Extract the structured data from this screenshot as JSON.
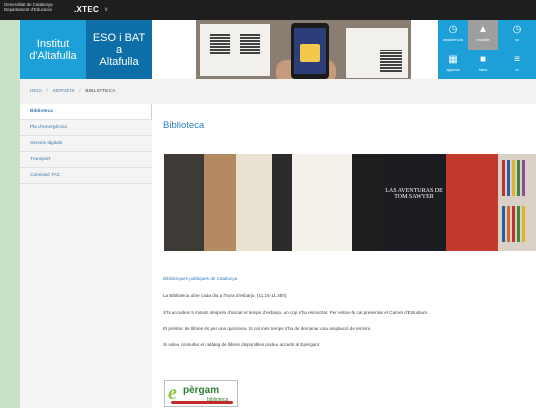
{
  "topbar": {
    "gencat_line1": "Generalitat de Catalunya",
    "gencat_line2": "Departament d'Educació",
    "xtec_label": ".XTEC",
    "xtec_chevron": "∨"
  },
  "banner": {
    "institut_label": "Institut\nd'Altafulla",
    "eso_label": "ESO i BAT a\nAltafulla",
    "tiles": [
      {
        "label": "assistència",
        "icon": "clock-icon",
        "color": "#1d9fd8"
      },
      {
        "label": "moodle",
        "icon": "graduation-cap-icon",
        "color": "#9e9e9e"
      },
      {
        "label": "co",
        "icon": "clock-icon",
        "color": "#1d9fd8"
      },
      {
        "label": "agenda",
        "icon": "calendar-icon",
        "color": "#1d9fd8"
      },
      {
        "label": "fotos",
        "icon": "camera-icon",
        "color": "#1d9fd8"
      },
      {
        "label": "m",
        "icon": "menu-icon",
        "color": "#1d9fd8"
      }
    ]
  },
  "breadcrumb": {
    "items": [
      "INICI",
      "SERVEIS",
      "BIBLIOTECA"
    ],
    "separator": "/"
  },
  "sidebar": {
    "items": [
      {
        "label": "Biblioteca",
        "active": true
      },
      {
        "label": "Pla d'emergència",
        "active": false
      },
      {
        "label": "Serveis digitals",
        "active": false
      },
      {
        "label": "Transport",
        "active": false
      },
      {
        "label": "Comissió TAC",
        "active": false
      }
    ]
  },
  "content": {
    "title": "Biblioteca",
    "hero_text": "LAS AVENTURAS DE TOM SAWYER",
    "link_text": "Biblioteques públiques de Catalunya",
    "paragraphs": [
      "La Biblioteca obre cada dia a l'hora d'esbarjo. (11.15-11.45h)",
      "S'hi accedeix 5 minuts després d'iniciat el temps d'esbarjo, un cop s'ha esmorzat. Per entrar-hi cal presentar el Carnet d'Estudiant.",
      "El préstec de llibres és per una quinzena. Si cal més temps s'ha de demanar una ampliació de termini.",
      "Si voleu consultar el catàleg de llibres disponibles podeu accedir al Epèrgam:"
    ],
    "epergam": {
      "word": "pèrgam",
      "sub": "biblioteca"
    },
    "social": [
      {
        "name": "facebook-icon",
        "color": "#3b5998",
        "glyph": "f"
      },
      {
        "name": "twitter-icon",
        "color": "#1da1f2",
        "glyph": "t"
      },
      {
        "name": "whatsapp-icon",
        "color": "#25d366",
        "glyph": "w"
      },
      {
        "name": "email-icon",
        "color": "#e53935",
        "glyph": "@"
      }
    ]
  },
  "colors": {
    "background": "#c7e2c6",
    "primary_blue": "#1d9fd8",
    "dark_blue": "#0d6ea8",
    "link_blue": "#2f7dbd"
  }
}
